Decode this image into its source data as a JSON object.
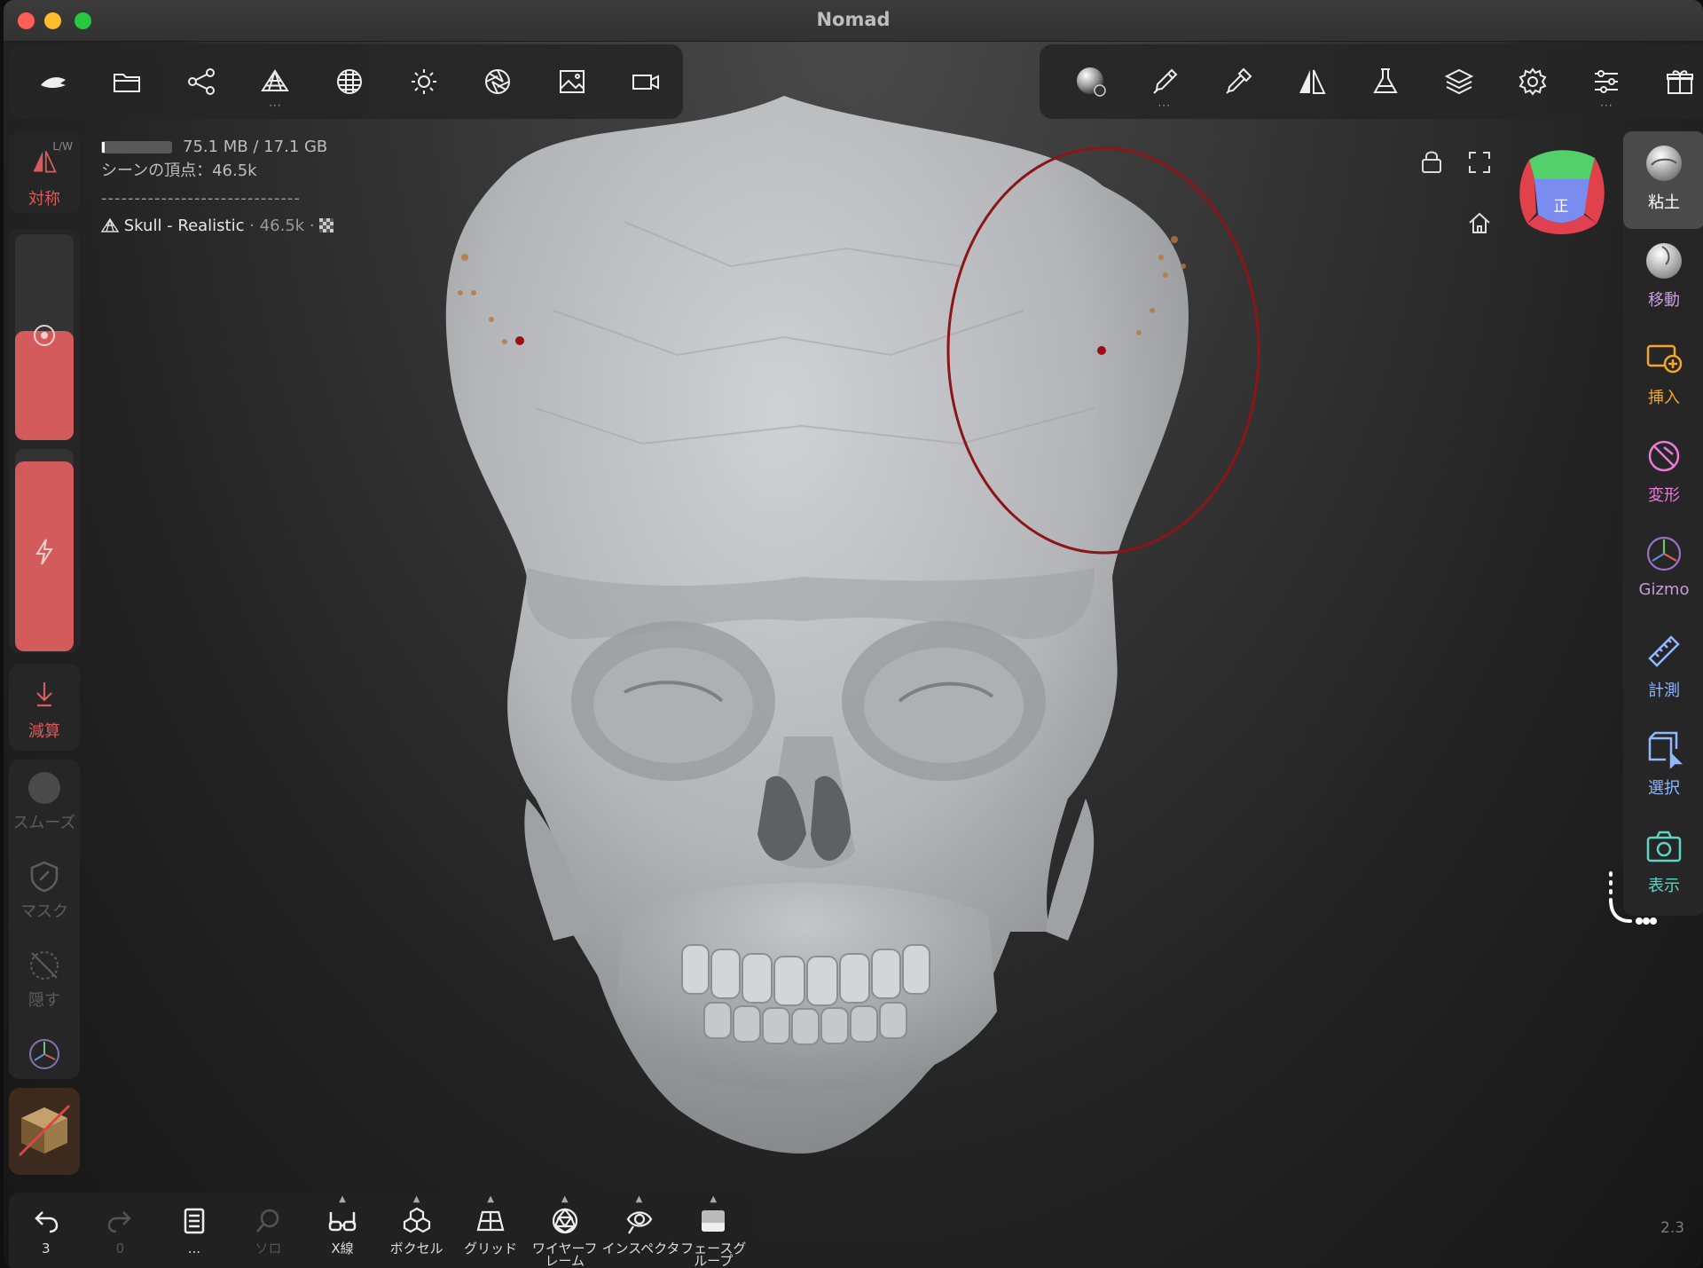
{
  "app": {
    "title": "Nomad"
  },
  "top_left_tools": [
    {
      "name": "logo-icon"
    },
    {
      "name": "folder-icon"
    },
    {
      "name": "scene-graph-icon"
    },
    {
      "name": "topology-icon"
    },
    {
      "name": "shading-sphere-icon"
    },
    {
      "name": "light-icon"
    },
    {
      "name": "postprocess-aperture-icon"
    },
    {
      "name": "background-image-icon"
    },
    {
      "name": "camera-icon"
    }
  ],
  "top_right_tools": [
    {
      "name": "material-sphere-icon"
    },
    {
      "name": "paint-brush-icon"
    },
    {
      "name": "pipette-icon"
    },
    {
      "name": "symmetry-icon"
    },
    {
      "name": "flask-icon"
    },
    {
      "name": "layers-icon"
    },
    {
      "name": "settings-gear-icon"
    },
    {
      "name": "sliders-icon"
    },
    {
      "name": "gift-icon"
    }
  ],
  "info": {
    "memory": "75.1 MB / 17.1 GB",
    "memory_fraction": 0.004,
    "vertices": "シーンの頂点：46.5k",
    "separator": "------------------------------",
    "mesh_name": "Skull - Realistic",
    "mesh_meta": "· 46.5k ·"
  },
  "left_sidebar": {
    "symmetry_label": "対称",
    "symmetry_mode": "L/W",
    "radius_fraction": 0.53,
    "intensity_fraction": 0.94,
    "subtract_label": "減算",
    "smooth_label": "スムーズ",
    "mask_label": "マスク",
    "hide_label": "隠す"
  },
  "right_sidebar": [
    {
      "label": "粘土",
      "color": "#ffffff",
      "active": true
    },
    {
      "label": "移動",
      "color": "#c99be0",
      "active": false
    },
    {
      "label": "挿入",
      "color": "#f5a623",
      "active": false
    },
    {
      "label": "変形",
      "color": "#e87ad8",
      "active": false
    },
    {
      "label": "Gizmo",
      "color": "#c99be0",
      "active": false
    },
    {
      "label": "計測",
      "color": "#8fb8ff",
      "active": false
    },
    {
      "label": "選択",
      "color": "#8fb8ff",
      "active": false
    },
    {
      "label": "表示",
      "color": "#5fd4c4",
      "active": false
    }
  ],
  "gizmo": {
    "face_label": "正"
  },
  "bottom_bar": [
    {
      "label": "3",
      "icon": "undo-icon",
      "dim": false,
      "caret": false
    },
    {
      "label": "0",
      "icon": "redo-icon",
      "dim": true,
      "caret": false
    },
    {
      "label": "...",
      "icon": "document-icon",
      "dim": false,
      "caret": false
    },
    {
      "label": "ソロ",
      "icon": "search-icon",
      "dim": true,
      "caret": false
    },
    {
      "label": "X線",
      "icon": "xray-glasses-icon",
      "dim": false,
      "caret": true
    },
    {
      "label": "ボクセル",
      "icon": "voxel-icon",
      "dim": false,
      "caret": true
    },
    {
      "label": "グリッド",
      "icon": "grid-icon",
      "dim": false,
      "caret": true
    },
    {
      "label": "ワイヤーフ\nレーム",
      "icon": "wireframe-icon",
      "dim": false,
      "caret": true
    },
    {
      "label": "インスペクタ",
      "icon": "inspector-eye-icon",
      "dim": false,
      "caret": true
    },
    {
      "label": "フェースグ\nループ",
      "icon": "facegroup-icon",
      "dim": false,
      "caret": true
    }
  ],
  "version": "2.3"
}
